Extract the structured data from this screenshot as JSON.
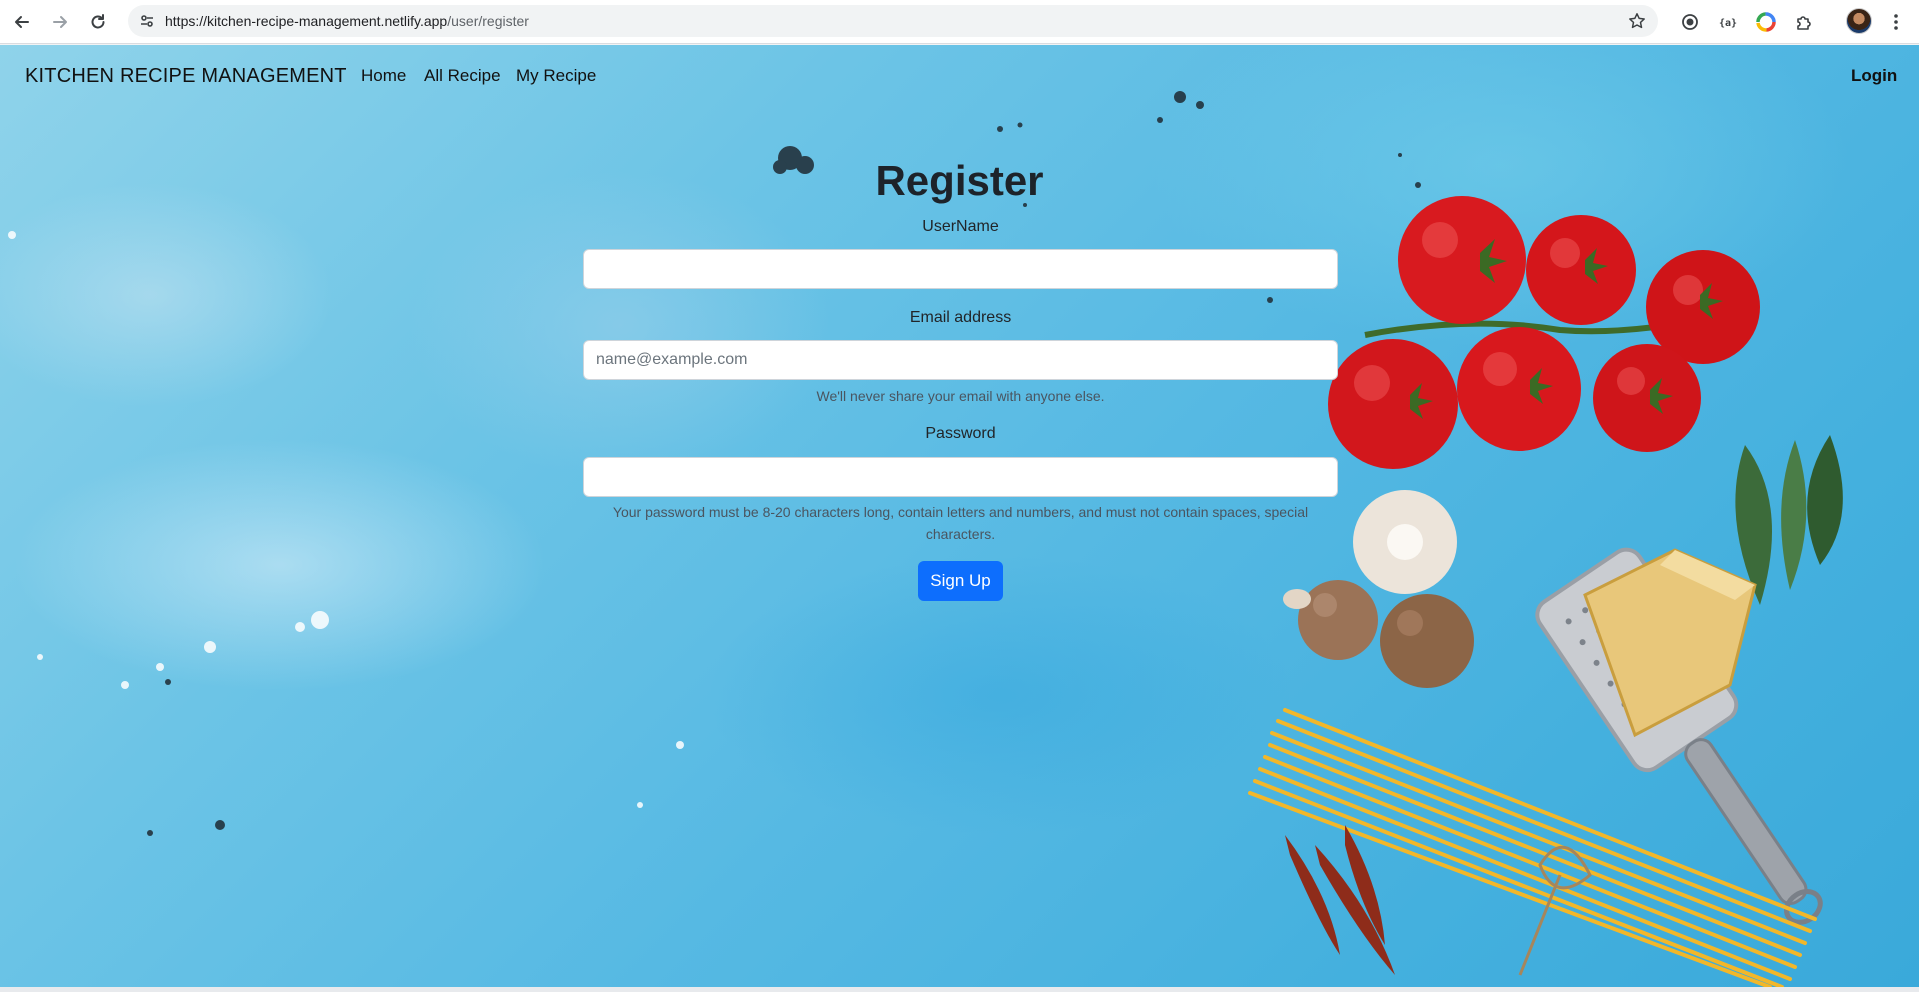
{
  "browser": {
    "url_host": "https://kitchen-recipe-management.netlify.app",
    "url_path": "/user/register",
    "icons": [
      "back-icon",
      "forward-icon",
      "reload-icon",
      "site-info-icon",
      "bookmark-star-icon",
      "extension-record-icon",
      "extension-code-icon",
      "extension-color-icon",
      "extensions-puzzle-icon",
      "profile-avatar",
      "more-menu-icon"
    ]
  },
  "navbar": {
    "brand": "KITCHEN RECIPE MANAGEMENT",
    "links": [
      "Home",
      "All Recipe",
      "My Recipe"
    ],
    "login": "Login"
  },
  "form": {
    "title": "Register",
    "username_label": "UserName",
    "username_value": "",
    "email_label": "Email address",
    "email_placeholder": "name@example.com",
    "email_help": "We'll never share your email with anyone else.",
    "password_label": "Password",
    "password_value": "",
    "password_help": "Your password must be 8-20 characters long, contain letters and numbers, and must not contain spaces, special characters.",
    "submit": "Sign Up"
  },
  "colors": {
    "primary_button": "#0d6efd",
    "background": "#56b9e3"
  }
}
